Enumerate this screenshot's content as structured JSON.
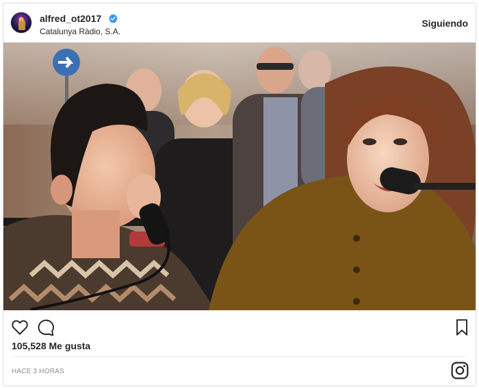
{
  "header": {
    "username": "alfred_ot2017",
    "location": "Catalunya Ràdio, S.A.",
    "follow_status": "Siguiendo"
  },
  "photo": {
    "description_icon": "post-photo"
  },
  "actions": {
    "like_icon": "heart-icon",
    "comment_icon": "comment-icon",
    "save_icon": "bookmark-icon"
  },
  "likes": {
    "text": "105,528 Me gusta"
  },
  "footer": {
    "timestamp": "HACE 3 HORAS",
    "logo_icon": "instagram-icon"
  },
  "colors": {
    "verified": "#3897f0",
    "text": "#262626",
    "muted": "#8e8e8e"
  }
}
